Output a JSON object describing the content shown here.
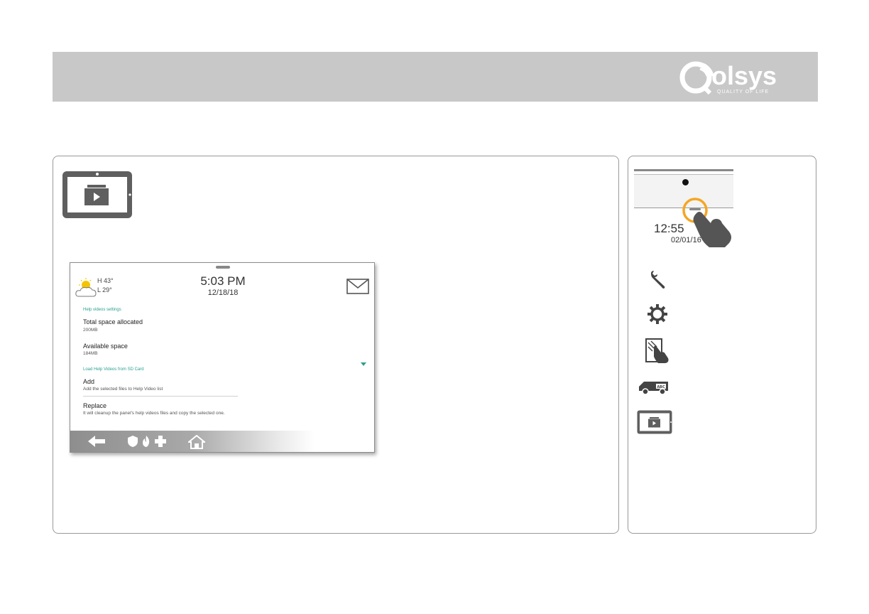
{
  "brand": {
    "logo_text": "olsys",
    "tagline": "QUALITY OF LIFE",
    "colors": {
      "banner": "#c8c8c8",
      "accent_teal": "#2aa18f",
      "highlight_orange": "#f5a623"
    }
  },
  "main_panel": {
    "hero_icon": "help-video-icon",
    "screen": {
      "weather": {
        "icon": "partly-cloudy-icon",
        "high": "H 43°",
        "low": "L 29°"
      },
      "time": "5:03 PM",
      "date": "12/18/18",
      "mail_icon": "envelope-icon",
      "sections": {
        "help_settings": "Help videos settings",
        "load_from_sd": "Load Help Videos from SD Card"
      },
      "items": {
        "total_space": {
          "title": "Total space allocated",
          "value": "200MB"
        },
        "available_space": {
          "title": "Available space",
          "value": "184MB"
        },
        "add": {
          "title": "Add",
          "description": "Add the selected files to Help Video list"
        },
        "replace": {
          "title": "Replace",
          "description": "It will cleanup the panel's help videos files and copy the selected one."
        }
      },
      "bottom_bar": [
        "back-arrow-icon",
        "shield-icon",
        "fire-icon",
        "medical-cross-icon",
        "home-icon"
      ]
    }
  },
  "side_panel": {
    "time_fragment": "12:55 ",
    "date_fragment": "02/01/16",
    "icons": [
      "wrench-icon",
      "gear-icon",
      "touch-calibration-icon",
      "service-van-icon",
      "help-video-icon"
    ]
  }
}
